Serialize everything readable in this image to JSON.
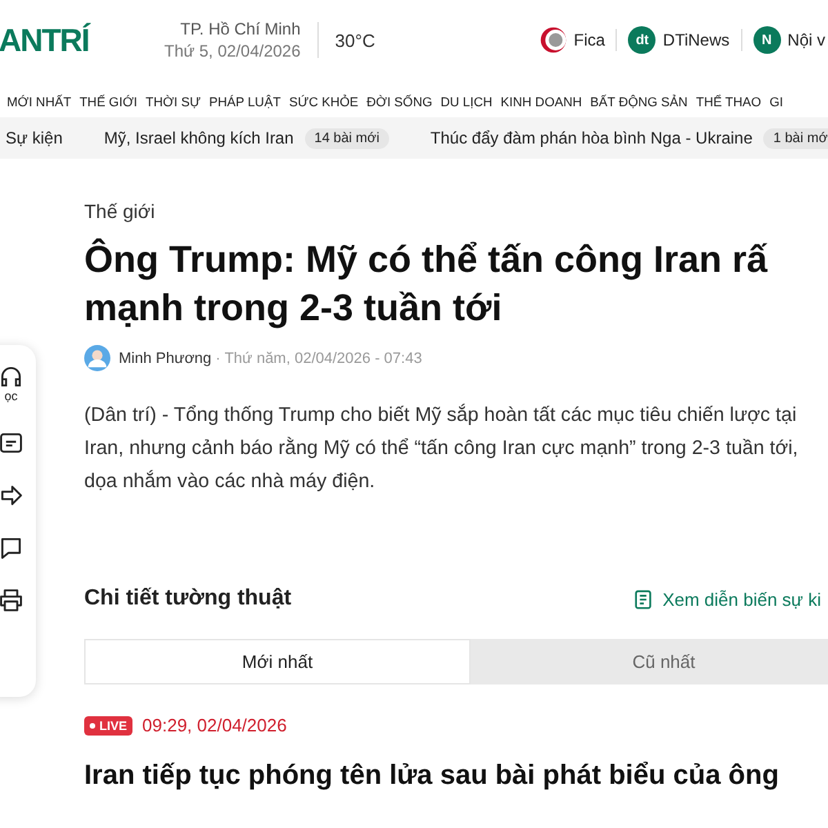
{
  "header": {
    "logo": "ANTRÍ",
    "location": "TP. Hồ Chí Minh",
    "date": "Thứ 5, 02/04/2026",
    "temperature": "30°C",
    "partners": [
      {
        "kind": "fica",
        "label": "Fica"
      },
      {
        "kind": "badge",
        "icon_text": "dt",
        "label": "DTiNews"
      },
      {
        "kind": "badge",
        "icon_text": "N",
        "label": "Nội v"
      }
    ]
  },
  "nav": [
    "MỚI NHẤT",
    "THẾ GIỚI",
    "THỜI SỰ",
    "PHÁP LUẬT",
    "SỨC KHỎE",
    "ĐỜI SỐNG",
    "DU LỊCH",
    "KINH DOANH",
    "BẤT ĐỘNG SẢN",
    "THỂ THAO",
    "GI"
  ],
  "topics": {
    "label": "Sự kiện",
    "items": [
      {
        "title": "Mỹ, Israel không kích Iran",
        "badge": "14 bài mới"
      },
      {
        "title": "Thúc đẩy đàm phán hòa bình Nga - Ukraine",
        "badge": "1 bài mớ"
      }
    ]
  },
  "side_tools": [
    {
      "kind": "listen",
      "label": "ọc"
    },
    {
      "kind": "summary"
    },
    {
      "kind": "share"
    },
    {
      "kind": "comment"
    },
    {
      "kind": "print"
    }
  ],
  "article": {
    "category": "Thế giới",
    "title_lines": [
      "Ông Trump: Mỹ có thể tấn công Iran rấ",
      "mạnh trong 2-3 tuần tới"
    ],
    "author": "Minh Phương",
    "published": "· Thứ năm, 02/04/2026 - 07:43",
    "lead": "(Dân trí) - Tổng thống Trump cho biết Mỹ sắp hoàn tất các mục tiêu chiến lược tại Iran, nhưng cảnh báo rằng Mỹ có thể “tấn công Iran cực mạnh” trong 2-3 tuần tới, dọa nhắm vào các nhà máy điện."
  },
  "live": {
    "section_title": "Chi tiết tường thuật",
    "timeline_link": "Xem diễn biến sự ki",
    "tabs": [
      {
        "label": "Mới nhất",
        "selected": true
      },
      {
        "label": "Cũ nhất",
        "selected": false
      }
    ],
    "entries": [
      {
        "badge": "LIVE",
        "time": "09:29, 02/04/2026",
        "headline": "Iran tiếp tục phóng tên lửa sau bài phát biểu của ông"
      }
    ]
  }
}
